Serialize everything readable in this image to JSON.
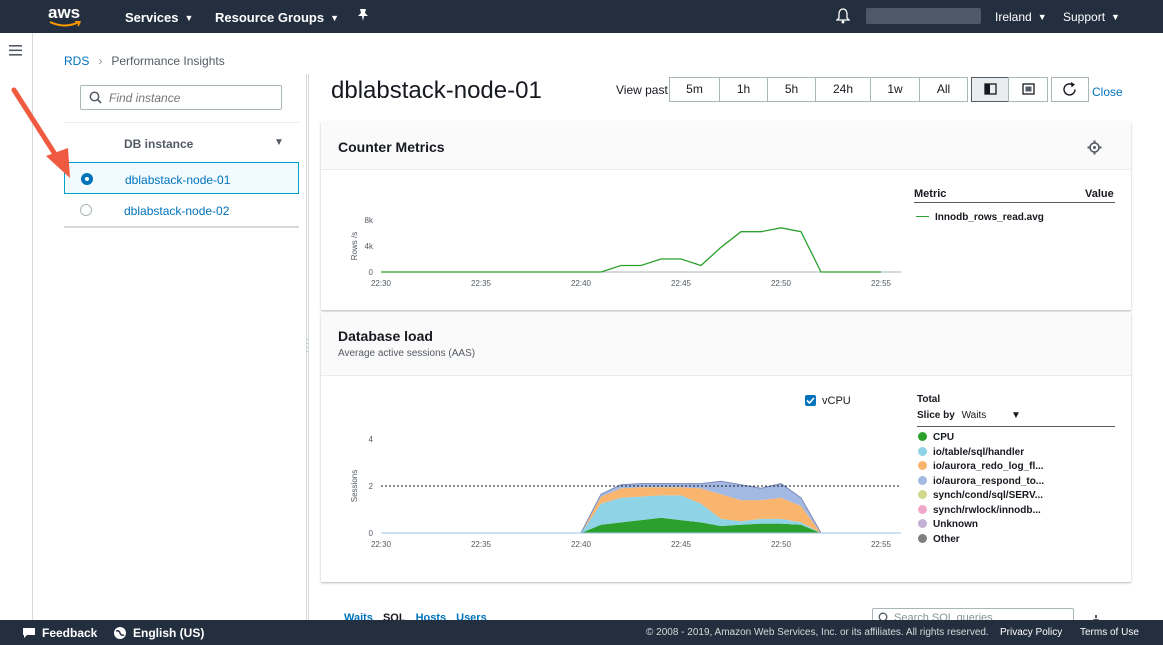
{
  "topnav": {
    "logo": "aws",
    "services": "Services",
    "resource_groups": "Resource Groups",
    "region": "Ireland",
    "support": "Support"
  },
  "breadcrumb": {
    "root": "RDS",
    "current": "Performance Insights"
  },
  "instance_panel": {
    "search_placeholder": "Find instance",
    "column_header": "DB instance",
    "instances": [
      {
        "name": "dblabstack-node-01",
        "selected": true
      },
      {
        "name": "dblabstack-node-02",
        "selected": false
      }
    ]
  },
  "header": {
    "title": "dblabstack-node-01",
    "view_past_label": "View past",
    "ranges": [
      "5m",
      "1h",
      "5h",
      "24h",
      "1w",
      "All"
    ],
    "close_label": "Close"
  },
  "counter_metrics": {
    "title": "Counter Metrics",
    "legend_metric": "Metric",
    "legend_value": "Value",
    "series_label": "Innodb_rows_read.avg",
    "series_color": "#2ca02c"
  },
  "database_load": {
    "title": "Database load",
    "subtitle": "Average active sessions (AAS)",
    "vcpu_label": "vCPU",
    "total_label": "Total",
    "slice_by_label": "Slice by",
    "slice_by_value": "Waits",
    "legend": [
      {
        "label": "CPU",
        "color": "#2ca02c"
      },
      {
        "label": "io/table/sql/handler",
        "color": "#8ed3e6"
      },
      {
        "label": "io/aurora_redo_log_fl...",
        "color": "#f9b56d"
      },
      {
        "label": "io/aurora_respond_to...",
        "color": "#a3b8e3"
      },
      {
        "label": "synch/cond/sql/SERV...",
        "color": "#d1d88a"
      },
      {
        "label": "synch/rwlock/innodb...",
        "color": "#f2a7c8"
      },
      {
        "label": "Unknown",
        "color": "#c5b0d5"
      },
      {
        "label": "Other",
        "color": "#7f7f7f"
      }
    ]
  },
  "chart_data": [
    {
      "type": "line",
      "title": "Counter Metrics",
      "ylabel": "Rows /s",
      "x_ticks": [
        "22:30",
        "22:35",
        "22:40",
        "22:45",
        "22:50",
        "22:55"
      ],
      "y_ticks": [
        "0",
        "4k",
        "8k"
      ],
      "ylim": [
        0,
        8000
      ],
      "series": [
        {
          "name": "Innodb_rows_read.avg",
          "x": [
            "22:30",
            "22:40",
            "22:41",
            "22:42",
            "22:43",
            "22:44",
            "22:45",
            "22:46",
            "22:47",
            "22:48",
            "22:49",
            "22:50",
            "22:51",
            "22:52",
            "22:55"
          ],
          "values": [
            0,
            0,
            0,
            1000,
            1000,
            2000,
            2000,
            1000,
            3800,
            6200,
            6200,
            6800,
            6200,
            0,
            0
          ]
        }
      ]
    },
    {
      "type": "area",
      "title": "Database load",
      "ylabel": "Sessions",
      "x_ticks": [
        "22:30",
        "22:35",
        "22:40",
        "22:45",
        "22:50",
        "22:55"
      ],
      "y_ticks": [
        "0",
        "2",
        "4"
      ],
      "ylim": [
        0,
        4
      ],
      "max_vcpu": 2,
      "x": [
        "22:40",
        "22:41",
        "22:42",
        "22:43",
        "22:44",
        "22:45",
        "22:46",
        "22:47",
        "22:48",
        "22:49",
        "22:50",
        "22:51",
        "22:52"
      ],
      "series": [
        {
          "name": "CPU",
          "values": [
            0,
            0.35,
            0.45,
            0.55,
            0.65,
            0.55,
            0.45,
            0.3,
            0.35,
            0.4,
            0.4,
            0.35,
            0
          ]
        },
        {
          "name": "io/table/sql/handler",
          "values": [
            0,
            0.9,
            1.05,
            1.0,
            0.95,
            1.05,
            0.8,
            0.3,
            0.15,
            0.2,
            0.2,
            0.1,
            0
          ]
        },
        {
          "name": "io/aurora_redo_log_fl...",
          "values": [
            0,
            0.3,
            0.4,
            0.4,
            0.35,
            0.35,
            0.65,
            1.05,
            0.9,
            0.8,
            0.9,
            0.7,
            0
          ]
        },
        {
          "name": "io/aurora_respond_to...",
          "values": [
            0,
            0.1,
            0.15,
            0.15,
            0.15,
            0.15,
            0.2,
            0.55,
            0.65,
            0.5,
            0.6,
            0.35,
            0
          ]
        }
      ]
    }
  ],
  "bottom_tabs": [
    "Waits",
    "SQL",
    "Hosts",
    "Users"
  ],
  "sql_search_placeholder": "Search SQL queries",
  "footer": {
    "feedback": "Feedback",
    "language": "English (US)",
    "copyright": "© 2008 - 2019, Amazon Web Services, Inc. or its affiliates. All rights reserved.",
    "privacy": "Privacy Policy",
    "terms": "Terms of Use"
  }
}
